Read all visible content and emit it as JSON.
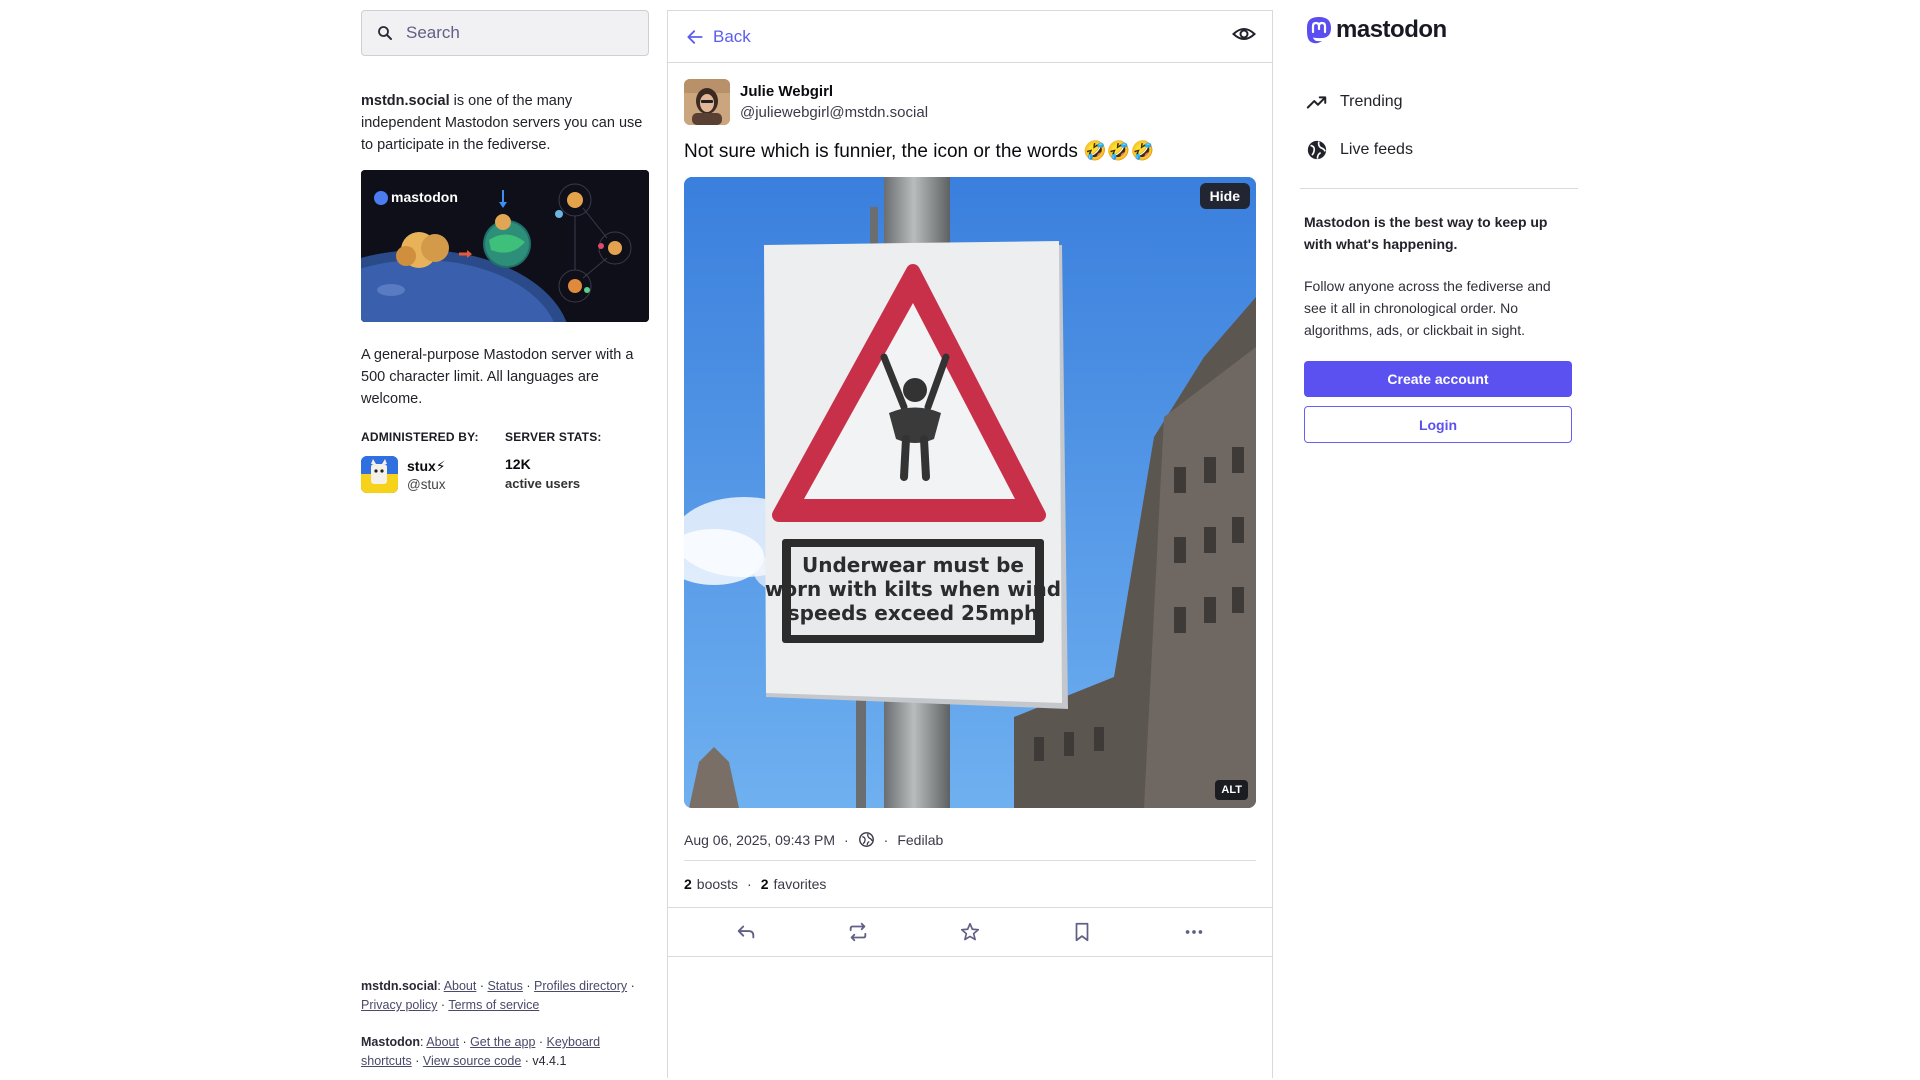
{
  "search": {
    "placeholder": "Search"
  },
  "server": {
    "name": "mstdn.social",
    "intro_rest": " is one of the many independent Mastodon servers you can use to participate in the fediverse.",
    "hero_logo": "mastodon",
    "description": "A general-purpose Mastodon server with a 500 character limit. All languages are welcome.",
    "administered_by_label": "ADMINISTERED BY:",
    "server_stats_label": "SERVER STATS:",
    "admin_name": "stux⚡",
    "admin_handle": "@stux",
    "active_users": "12K",
    "active_users_label": "active users"
  },
  "footer": {
    "server_label": "mstdn.social",
    "server_links": [
      "About",
      "Status",
      "Profiles directory",
      "Privacy policy",
      "Terms of service"
    ],
    "mastodon_label": "Mastodon",
    "mastodon_links": [
      "About",
      "Get the app",
      "Keyboard shortcuts",
      "View source code"
    ],
    "version": "v4.4.1"
  },
  "topbar": {
    "back_label": "Back",
    "eye_icon": "eye-icon"
  },
  "post": {
    "author_name": "Julie Webgirl",
    "author_handle": "@juliewebgirl@mstdn.social",
    "text": "Not sure which is funnier, the icon or the words 🤣🤣🤣",
    "hide_label": "Hide",
    "alt_label": "ALT",
    "sign_text_line1": "Underwear must be",
    "sign_text_line2": "worn with kilts when wind",
    "sign_text_line3": "speeds exceed 25mph",
    "timestamp": "Aug 06, 2025, 09:43 PM",
    "visibility_icon": "globe-icon",
    "application": "Fedilab",
    "boosts_count": "2",
    "boosts_label": "boosts",
    "favorites_count": "2",
    "favorites_label": "favorites"
  },
  "actions": [
    "reply-icon",
    "boost-icon",
    "favorite-icon",
    "bookmark-icon",
    "more-icon"
  ],
  "right": {
    "logo_text": "mastodon",
    "nav": [
      {
        "label": "Trending",
        "icon": "trending-icon"
      },
      {
        "label": "Live feeds",
        "icon": "globe-icon"
      }
    ],
    "pitch_title": "Mastodon is the best way to keep up with what's happening.",
    "pitch_body": "Follow anyone across the fediverse and see it all in chronological order. No algorithms, ads, or clickbait in sight.",
    "create_account": "Create account",
    "login": "Login"
  },
  "colors": {
    "accent": "#5b50f0",
    "link": "#5c5cf0",
    "border": "#d8d8de"
  }
}
